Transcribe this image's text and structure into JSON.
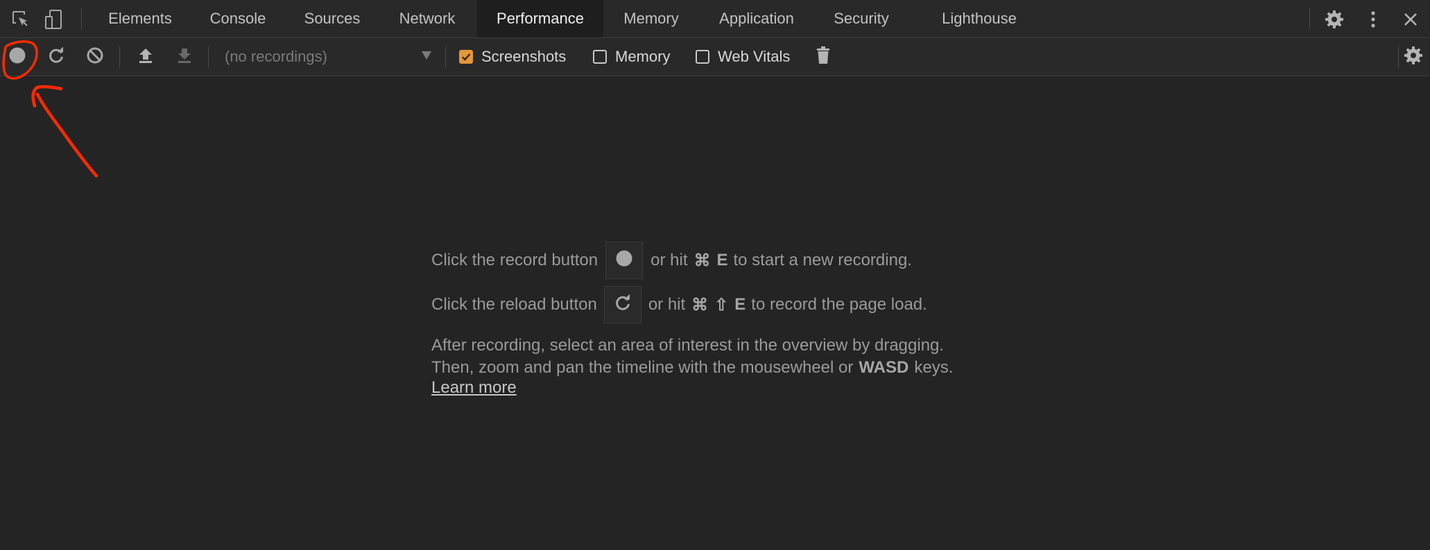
{
  "tabs": [
    {
      "label": "Elements",
      "active": false
    },
    {
      "label": "Console",
      "active": false
    },
    {
      "label": "Sources",
      "active": false
    },
    {
      "label": "Network",
      "active": false
    },
    {
      "label": "Performance",
      "active": true
    },
    {
      "label": "Memory",
      "active": false
    },
    {
      "label": "Application",
      "active": false
    },
    {
      "label": "Security",
      "active": false
    },
    {
      "label": "Lighthouse",
      "active": false
    }
  ],
  "toolbar": {
    "recordings_select": "(no recordings)",
    "checkboxes": [
      {
        "label": "Screenshots",
        "checked": true
      },
      {
        "label": "Memory",
        "checked": false
      },
      {
        "label": "Web Vitals",
        "checked": false
      }
    ]
  },
  "landing": {
    "record_line": {
      "before": "Click the record button",
      "after": "or hit",
      "shortcut_cmd": "⌘",
      "shortcut_key": "E",
      "end": "to start a new recording."
    },
    "reload_line": {
      "before": "Click the reload button",
      "after": "or hit",
      "shortcut_cmd": "⌘",
      "shortcut_shift": "⇧",
      "shortcut_key": "E",
      "end": "to record the page load."
    },
    "after_line_1": "After recording, select an area of interest in the overview by dragging.",
    "after_line_2_before": "Then, zoom and pan the timeline with the mousewheel or",
    "after_line_2_keys": "WASD",
    "after_line_2_end": "keys.",
    "learn_more": "Learn more"
  },
  "colors": {
    "background": "#242424",
    "bar": "#292929",
    "checkbox_accent": "#e4963a",
    "annotation": "#ff2a00"
  }
}
